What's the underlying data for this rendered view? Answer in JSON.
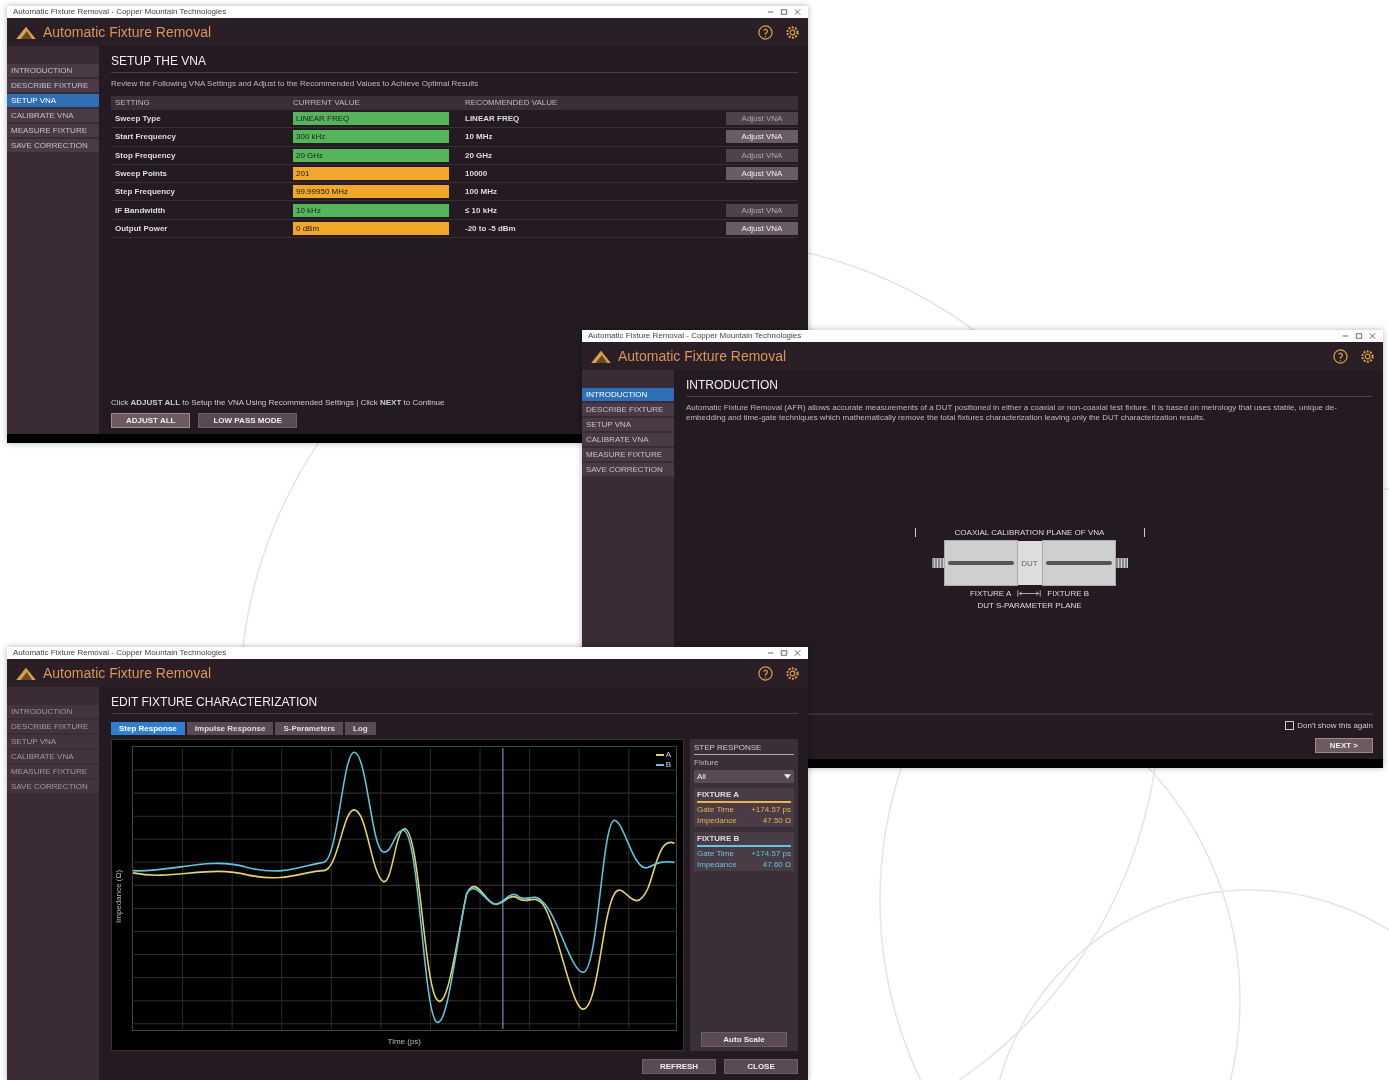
{
  "setup_window": {
    "title_bar": "Automatic Fixture Removal - Copper Mountain Technologies",
    "app_title": "Automatic Fixture Removal",
    "sidebar": [
      {
        "label": "INTRODUCTION",
        "selected": false
      },
      {
        "label": "DESCRIBE FIXTURE",
        "selected": false
      },
      {
        "label": "SETUP VNA",
        "selected": true
      },
      {
        "label": "CALIBRATE VNA",
        "selected": false
      },
      {
        "label": "MEASURE FIXTURE",
        "selected": false
      },
      {
        "label": "SAVE CORRECTION",
        "selected": false
      }
    ],
    "heading": "SETUP THE VNA",
    "subtitle": "Review the Following VNA Settings and Adjust to the Recommended Values to Achieve Optimal Results",
    "columns": [
      "SETTING",
      "CURRENT VALUE",
      "RECOMMENDED VALUE"
    ],
    "rows": [
      {
        "setting": "Sweep Type",
        "current": "LINEAR FREQ",
        "ok": true,
        "recommended": "LINEAR FREQ",
        "button": {
          "label": "Adjust VNA",
          "disabled": true
        }
      },
      {
        "setting": "Start Frequency",
        "current": "300 kHz",
        "ok": true,
        "recommended": "10 MHz",
        "button": {
          "label": "Adjust VNA",
          "disabled": false
        }
      },
      {
        "setting": "Stop Frequency",
        "current": "20 GHz",
        "ok": true,
        "recommended": "20 GHz",
        "button": {
          "label": "Adjust VNA",
          "disabled": true
        }
      },
      {
        "setting": "Sweep Points",
        "current": "201",
        "ok": false,
        "recommended": "10000",
        "button": {
          "label": "Adjust VNA",
          "disabled": false
        }
      },
      {
        "setting": "Step Frequency",
        "current": "99.99950 MHz",
        "ok": false,
        "recommended": "100 MHz"
      },
      {
        "setting": "IF Bandwidth",
        "current": "10 kHz",
        "ok": true,
        "recommended": "≤ 10 kHz",
        "button": {
          "label": "Adjust VNA",
          "disabled": true
        }
      },
      {
        "setting": "Output Power",
        "current": "0 dBm",
        "ok": false,
        "recommended": "-20 to -5 dBm",
        "button": {
          "label": "Adjust VNA",
          "disabled": false
        }
      }
    ],
    "instruction": "Click **ADJUST ALL** to Setup the VNA Using Recommended Settings | Click **NEXT** to Continue",
    "buttons": [
      "ADJUST ALL",
      "LOW PASS MODE"
    ]
  },
  "intro_window": {
    "title_bar": "Automatic Fixture Removal - Copper Mountain Technologies",
    "app_title": "Automatic Fixture Removal",
    "sidebar": [
      {
        "label": "INTRODUCTION",
        "selected": true
      },
      {
        "label": "DESCRIBE FIXTURE",
        "selected": false
      },
      {
        "label": "SETUP VNA",
        "selected": false
      },
      {
        "label": "CALIBRATE VNA",
        "selected": false
      },
      {
        "label": "MEASURE FIXTURE",
        "selected": false
      },
      {
        "label": "SAVE CORRECTION",
        "selected": false
      }
    ],
    "heading": "INTRODUCTION",
    "text": "Automatic Fixture Removal (AFR) allows accurate measurements of a DUT positioned in either a coaxial or non-coaxial test fixture. It is based on metrology that uses stable, unique de-embedding and time-gate techniques which mathematically remove the total fixtures characterization leaving only the DUT characterization results.",
    "diagram": {
      "top_label": "COAXIAL CALIBRATION PLANE OF VNA",
      "dut": "DUT",
      "fixture_a": "FIXTURE A",
      "fixture_b": "FIXTURE B",
      "bottom_label": "DUT S-PARAMETER PLANE"
    },
    "dont_show": {
      "label": "Don't show this again",
      "checked": false
    },
    "next_button": "NEXT >"
  },
  "chart_window": {
    "title_bar": "Automatic Fixture Removal - Copper Mountain Technologies",
    "app_title": "Automatic Fixture Removal",
    "sidebar": [
      {
        "label": "INTRODUCTION",
        "disabled": true
      },
      {
        "label": "DESCRIBE FIXTURE",
        "disabled": true
      },
      {
        "label": "SETUP VNA",
        "disabled": true
      },
      {
        "label": "CALIBRATE VNA",
        "disabled": true
      },
      {
        "label": "MEASURE FIXTURE",
        "disabled": true
      },
      {
        "label": "SAVE CORRECTION",
        "disabled": true
      }
    ],
    "heading": "EDIT FIXTURE CHARACTERIZATION",
    "tabs": [
      {
        "label": "Step Response",
        "selected": true
      },
      {
        "label": "Impulse Response",
        "selected": false
      },
      {
        "label": "S-Parameters",
        "selected": false
      },
      {
        "label": "Log",
        "selected": false
      }
    ],
    "legend": [
      {
        "label": "A",
        "color": "#e8d36a"
      },
      {
        "label": "B",
        "color": "#5fc8e0"
      }
    ],
    "xlabel": "Time (ps)",
    "ylabel": "Impedance (Ω)",
    "panel": {
      "title": "STEP RESPONSE",
      "fixture_label": "Fixture",
      "dropdown": "All",
      "fixtures": [
        {
          "name": "FIXTURE A",
          "color": "#e8b54a",
          "rows": [
            {
              "label": "Gate Time",
              "value": "+174.57 ps"
            },
            {
              "label": "Impedance",
              "value": "47.50 Ω"
            }
          ]
        },
        {
          "name": "FIXTURE B",
          "color": "#5fc8e0",
          "rows": [
            {
              "label": "Gate Time",
              "value": "+174.57 ps"
            },
            {
              "label": "Impedance",
              "value": "47.60 Ω"
            }
          ]
        }
      ],
      "auto_scale": "Auto Scale"
    },
    "buttons": [
      "REFRESH",
      "CLOSE"
    ]
  }
}
